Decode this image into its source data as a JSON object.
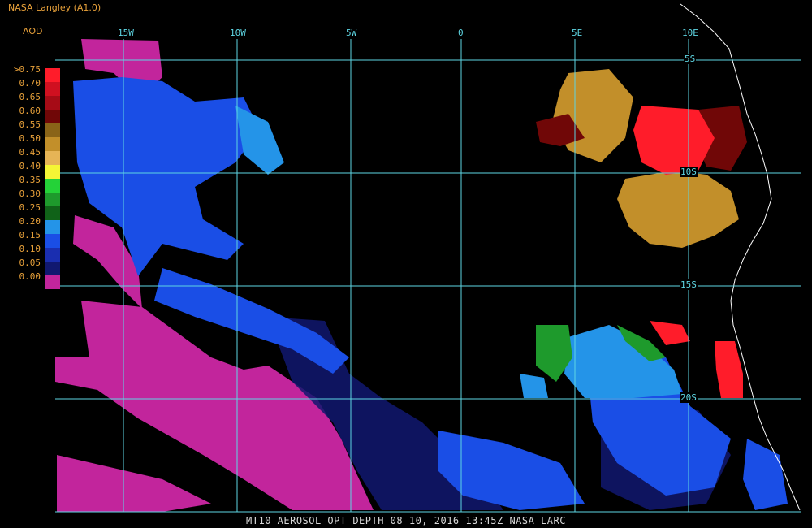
{
  "header": {
    "source": "NASA Langley (A1.0)",
    "product": "AOD"
  },
  "longitude_labels": [
    "15W",
    "10W",
    "5W",
    "0",
    "5E",
    "10E"
  ],
  "latitude_labels": [
    "5S",
    "10S",
    "15S",
    "20S"
  ],
  "legend": {
    "labels": [
      ">0.75",
      "0.70",
      "0.65",
      "0.60",
      "0.55",
      "0.50",
      "0.45",
      "0.40",
      "0.35",
      "0.30",
      "0.25",
      "0.20",
      "0.15",
      "0.10",
      "0.05",
      "0.00"
    ],
    "colors": [
      "#ff1c2a",
      "#d01020",
      "#a60b16",
      "#700707",
      "#8a6418",
      "#c28f2a",
      "#e6b456",
      "#f5f535",
      "#24d238",
      "#1e9a2c",
      "#106218",
      "#2494e8",
      "#1a4ee6",
      "#1a2eb0",
      "#111870",
      "#c2259c"
    ]
  },
  "colors": {
    "grid": "#5ed6e3",
    "coast": "#ffffff",
    "label": "#e8a13a",
    "ocean": "#000000"
  },
  "footer": {
    "text": "MT10  AEROSOL OPT DEPTH   08 10, 2016 13:45Z   NASA LARC"
  }
}
